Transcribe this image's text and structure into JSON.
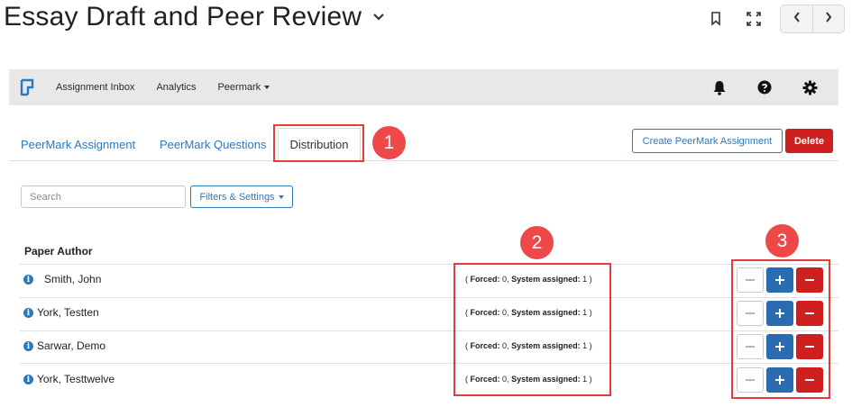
{
  "page": {
    "title": "Essay Draft and Peer Review"
  },
  "top_icons": [
    "bookmark-icon",
    "fullscreen-icon",
    "chevron-left-icon",
    "chevron-right-icon"
  ],
  "toolbar": {
    "logo": "turnitin-logo",
    "menu": [
      {
        "label": "Assignment Inbox"
      },
      {
        "label": "Analytics"
      },
      {
        "label": "Peermark"
      }
    ],
    "icons": [
      "bell-icon",
      "help-icon",
      "gear-icon"
    ]
  },
  "tabs": {
    "peermark_assignment": "PeerMark Assignment",
    "peermark_questions": "PeerMark Questions",
    "distribution": "Distribution"
  },
  "actions": {
    "create_label": "Create PeerMark Assignment",
    "delete_label": "Delete"
  },
  "filters": {
    "search_placeholder": "Search",
    "filters_label": "Filters & Settings"
  },
  "table": {
    "header": "Paper Author",
    "forced_label": "Forced:",
    "system_label": "System assigned:",
    "rows": [
      {
        "author": "Smith, John",
        "forced": "0",
        "system": "1"
      },
      {
        "author": "York, Testten",
        "forced": "0",
        "system": "1"
      },
      {
        "author": "Sarwar, Demo",
        "forced": "0",
        "system": "1"
      },
      {
        "author": "York, Testtwelve",
        "forced": "0",
        "system": "1"
      }
    ]
  },
  "callouts": {
    "one": "1",
    "two": "2",
    "three": "3"
  },
  "colors": {
    "link_blue": "#2e78b8",
    "delete_red": "#cf2020",
    "plus_blue": "#2b6cb0",
    "callout_red": "#e53d3d",
    "toolbar_gray": "#e8e8e8"
  }
}
